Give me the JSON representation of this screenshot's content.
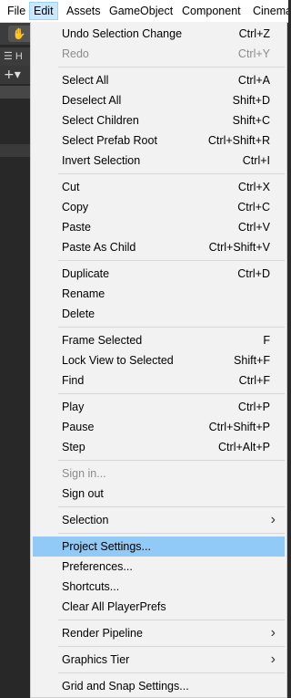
{
  "menubar": {
    "items": [
      "File",
      "Edit",
      "Assets",
      "GameObject",
      "Component",
      "Cinema"
    ]
  },
  "editor": {
    "hierarchy_tab": "☰ H",
    "add_button": "+▾"
  },
  "menu": {
    "items": [
      {
        "label": "Undo Selection Change",
        "shortcut": "Ctrl+Z"
      },
      {
        "label": "Redo",
        "shortcut": "Ctrl+Y",
        "disabled": true
      },
      {
        "sep": true
      },
      {
        "label": "Select All",
        "shortcut": "Ctrl+A"
      },
      {
        "label": "Deselect All",
        "shortcut": "Shift+D"
      },
      {
        "label": "Select Children",
        "shortcut": "Shift+C"
      },
      {
        "label": "Select Prefab Root",
        "shortcut": "Ctrl+Shift+R"
      },
      {
        "label": "Invert Selection",
        "shortcut": "Ctrl+I"
      },
      {
        "sep": true
      },
      {
        "label": "Cut",
        "shortcut": "Ctrl+X"
      },
      {
        "label": "Copy",
        "shortcut": "Ctrl+C"
      },
      {
        "label": "Paste",
        "shortcut": "Ctrl+V"
      },
      {
        "label": "Paste As Child",
        "shortcut": "Ctrl+Shift+V"
      },
      {
        "sep": true
      },
      {
        "label": "Duplicate",
        "shortcut": "Ctrl+D"
      },
      {
        "label": "Rename",
        "shortcut": ""
      },
      {
        "label": "Delete",
        "shortcut": ""
      },
      {
        "sep": true
      },
      {
        "label": "Frame Selected",
        "shortcut": "F"
      },
      {
        "label": "Lock View to Selected",
        "shortcut": "Shift+F"
      },
      {
        "label": "Find",
        "shortcut": "Ctrl+F"
      },
      {
        "sep": true
      },
      {
        "label": "Play",
        "shortcut": "Ctrl+P"
      },
      {
        "label": "Pause",
        "shortcut": "Ctrl+Shift+P"
      },
      {
        "label": "Step",
        "shortcut": "Ctrl+Alt+P"
      },
      {
        "sep": true
      },
      {
        "label": "Sign in...",
        "shortcut": "",
        "disabled": true
      },
      {
        "label": "Sign out",
        "shortcut": ""
      },
      {
        "sep": true
      },
      {
        "label": "Selection",
        "shortcut": "",
        "submenu": true
      },
      {
        "sep": true
      },
      {
        "label": "Project Settings...",
        "shortcut": "",
        "highlighted": true
      },
      {
        "label": "Preferences...",
        "shortcut": ""
      },
      {
        "label": "Shortcuts...",
        "shortcut": ""
      },
      {
        "label": "Clear All PlayerPrefs",
        "shortcut": ""
      },
      {
        "sep": true
      },
      {
        "label": "Render Pipeline",
        "shortcut": "",
        "submenu": true
      },
      {
        "sep": true
      },
      {
        "label": "Graphics Tier",
        "shortcut": "",
        "submenu": true
      },
      {
        "sep": true
      },
      {
        "label": "Grid and Snap Settings...",
        "shortcut": ""
      }
    ]
  },
  "icons": {
    "hand_tool": "hand-icon",
    "submenu_arrow": "chevron-right-icon"
  },
  "colors": {
    "highlight": "#91c9f7",
    "menubar_open": "#cce8ff",
    "menu_bg": "#f2f2f2",
    "editor_bg": "#282828"
  }
}
